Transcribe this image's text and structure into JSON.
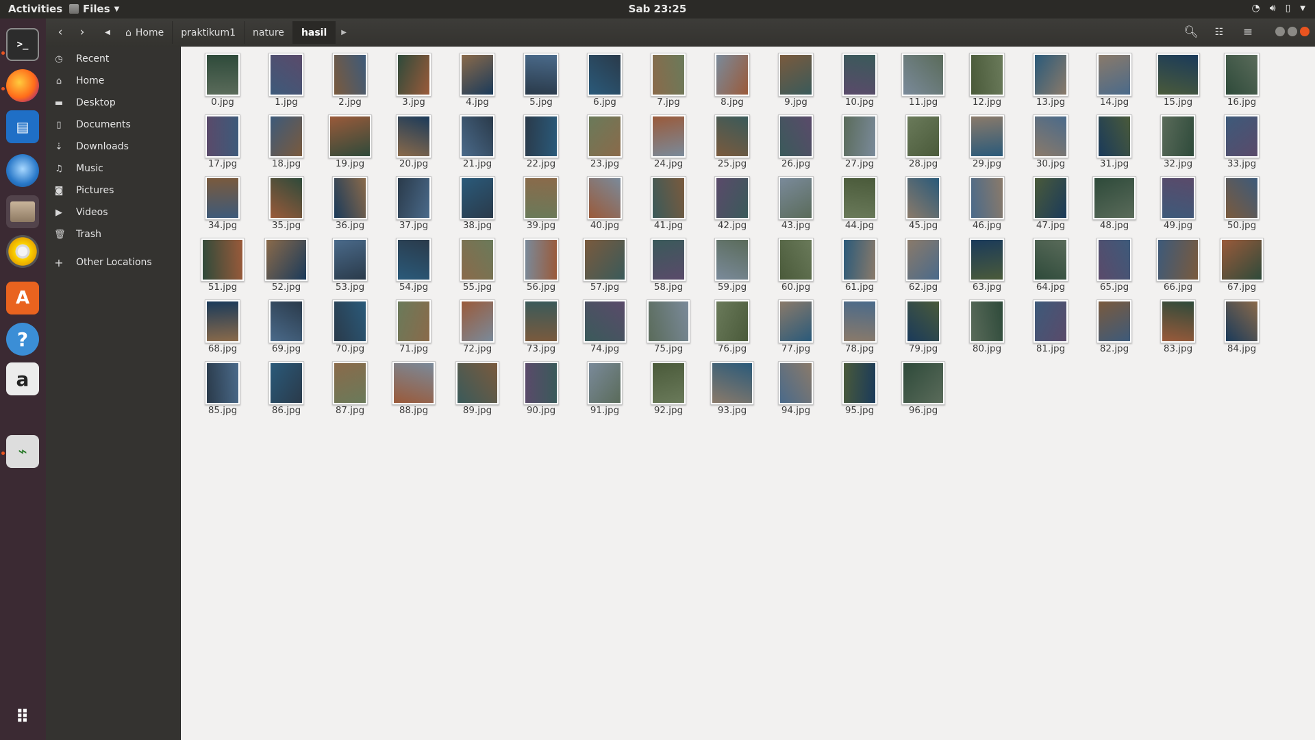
{
  "topbar": {
    "activities": "Activities",
    "app_name": "Files",
    "clock": "Sab 23:25",
    "tray_icons": [
      "wifi-icon",
      "volume-icon",
      "battery-icon",
      "system-menu-chevron"
    ]
  },
  "dock": {
    "apps": [
      "terminal",
      "firefox",
      "libreoffice-writer",
      "thunderbird",
      "files",
      "rhythmbox",
      "software-center",
      "help",
      "amazon",
      "system-monitor"
    ],
    "show_apps": "show-applications"
  },
  "headerbar": {
    "breadcrumbs": [
      "Home",
      "praktikum1",
      "nature",
      "hasil"
    ]
  },
  "sidebar": {
    "items": [
      {
        "label": "Recent",
        "icon": "clock-icon"
      },
      {
        "label": "Home",
        "icon": "home-icon"
      },
      {
        "label": "Desktop",
        "icon": "folder-icon"
      },
      {
        "label": "Documents",
        "icon": "document-icon"
      },
      {
        "label": "Downloads",
        "icon": "download-icon"
      },
      {
        "label": "Music",
        "icon": "music-icon"
      },
      {
        "label": "Pictures",
        "icon": "camera-icon"
      },
      {
        "label": "Videos",
        "icon": "video-icon"
      },
      {
        "label": "Trash",
        "icon": "trash-icon"
      }
    ],
    "other": {
      "label": "Other Locations",
      "icon": "plus-icon"
    }
  },
  "files": [
    "0.jpg",
    "1.jpg",
    "2.jpg",
    "3.jpg",
    "4.jpg",
    "5.jpg",
    "6.jpg",
    "7.jpg",
    "8.jpg",
    "9.jpg",
    "10.jpg",
    "11.jpg",
    "12.jpg",
    "13.jpg",
    "14.jpg",
    "15.jpg",
    "16.jpg",
    "17.jpg",
    "18.jpg",
    "19.jpg",
    "20.jpg",
    "21.jpg",
    "22.jpg",
    "23.jpg",
    "24.jpg",
    "25.jpg",
    "26.jpg",
    "27.jpg",
    "28.jpg",
    "29.jpg",
    "30.jpg",
    "31.jpg",
    "32.jpg",
    "33.jpg",
    "34.jpg",
    "35.jpg",
    "36.jpg",
    "37.jpg",
    "38.jpg",
    "39.jpg",
    "40.jpg",
    "41.jpg",
    "42.jpg",
    "43.jpg",
    "44.jpg",
    "45.jpg",
    "46.jpg",
    "47.jpg",
    "48.jpg",
    "49.jpg",
    "50.jpg",
    "51.jpg",
    "52.jpg",
    "53.jpg",
    "54.jpg",
    "55.jpg",
    "56.jpg",
    "57.jpg",
    "58.jpg",
    "59.jpg",
    "60.jpg",
    "61.jpg",
    "62.jpg",
    "63.jpg",
    "64.jpg",
    "65.jpg",
    "66.jpg",
    "67.jpg",
    "68.jpg",
    "69.jpg",
    "70.jpg",
    "71.jpg",
    "72.jpg",
    "73.jpg",
    "74.jpg",
    "75.jpg",
    "76.jpg",
    "77.jpg",
    "78.jpg",
    "79.jpg",
    "80.jpg",
    "81.jpg",
    "82.jpg",
    "83.jpg",
    "84.jpg",
    "85.jpg",
    "86.jpg",
    "87.jpg",
    "88.jpg",
    "89.jpg",
    "90.jpg",
    "91.jpg",
    "92.jpg",
    "93.jpg",
    "94.jpg",
    "95.jpg",
    "96.jpg"
  ],
  "colors": {
    "accent": "#e95420",
    "thumb_palette": [
      "#5a6b5a",
      "#3d5a7a",
      "#7a5a3d",
      "#2e4a3a",
      "#8a6a4a",
      "#4a6a8a",
      "#2a3a4a",
      "#6a7a5a",
      "#9a5a3a",
      "#3a5a5a",
      "#5a4a6a",
      "#7a8a9a",
      "#4a5a3a",
      "#2a5a7a",
      "#8a7a6a",
      "#1a3a5a"
    ]
  }
}
